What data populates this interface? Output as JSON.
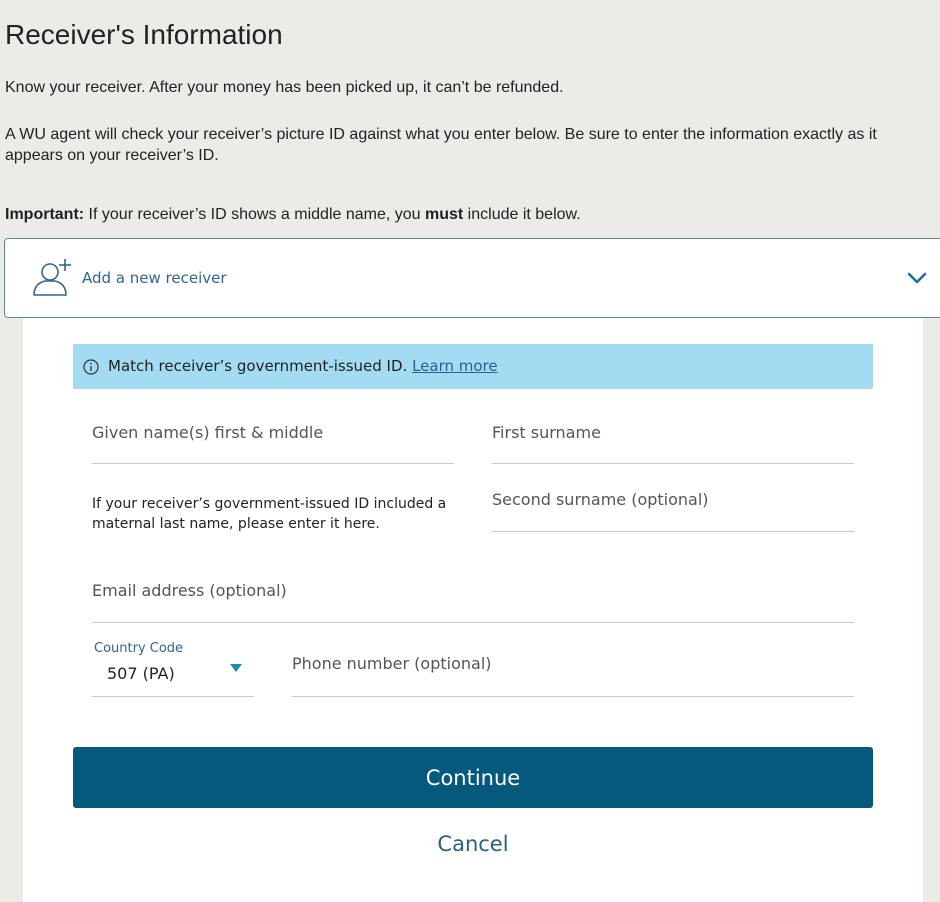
{
  "page": {
    "title": "Receiver's Information",
    "intro": "Know your receiver. After your money has been picked up, it can’t be refunded.",
    "agent_note": "A WU agent will check your receiver’s picture ID against what you enter below. Be sure to enter the information exactly as it appears on your receiver’s ID.",
    "important_label": "Important:",
    "important_pre": " If your receiver’s ID shows a middle name, you ",
    "important_emphasis": "must",
    "important_post": " include it below."
  },
  "receiver_selector": {
    "label": "Add a new receiver",
    "icon": "add-user-icon",
    "expanded_icon": "chevron-down-icon"
  },
  "form": {
    "banner": {
      "text": "Match receiver’s government-issued ID.",
      "link": "Learn more",
      "icon": "info-circle-icon",
      "color": "#a3dbf3"
    },
    "given_names": {
      "placeholder": "Given name(s) first & middle",
      "value": ""
    },
    "first_surname": {
      "placeholder": "First surname",
      "value": ""
    },
    "second_surname": {
      "placeholder": "Second surname (optional)",
      "value": ""
    },
    "maternal_hint": "If your receiver’s government-issued ID included a maternal last name, please enter it here.",
    "email": {
      "placeholder": "Email address (optional)",
      "value": ""
    },
    "country_code": {
      "label": "Country Code",
      "value": "507 (PA)"
    },
    "phone": {
      "placeholder": "Phone number (optional)",
      "value": ""
    },
    "continue_label": "Continue",
    "cancel_label": "Cancel"
  },
  "colors": {
    "primary_button": "#04597c",
    "link": "#2f5f86",
    "page_background": "#ecebe8"
  }
}
